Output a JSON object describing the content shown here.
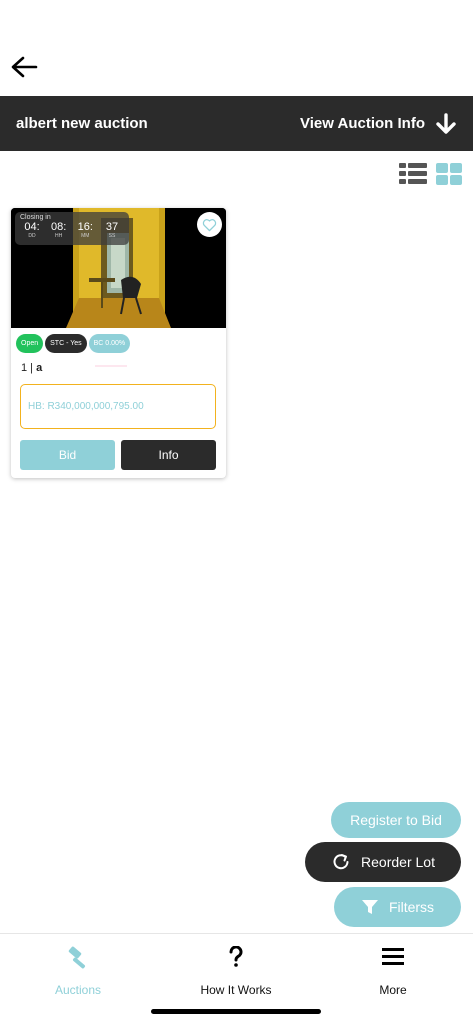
{
  "nav": {
    "back_icon": "arrow-left-icon"
  },
  "header": {
    "title": "albert new auction",
    "view_info_label": "View Auction Info",
    "view_info_icon": "arrow-down-icon"
  },
  "view_toggles": {
    "list_icon": "list-view-icon",
    "grid_icon": "grid-view-icon",
    "active": "grid"
  },
  "lot_card": {
    "timer": {
      "label": "Closing in",
      "days": "04:",
      "hours": "08:",
      "minutes": "16:",
      "seconds": "37",
      "days_unit": "DD",
      "hours_unit": "HH",
      "minutes_unit": "MM",
      "seconds_unit": "SS"
    },
    "favorite_icon": "heart-outline-icon",
    "badges": {
      "status": "Open",
      "stc": "STC - Yes",
      "bc": "BC 0.00%"
    },
    "lot_number": "1 |",
    "lot_name": "a",
    "highest_bid": "HB: R340,000,000,795.00",
    "bid_label": "Bid",
    "info_label": "Info"
  },
  "actions": {
    "register_label": "Register to Bid",
    "reorder_label": "Reorder Lot",
    "filter_label": "Filterss",
    "reorder_icon": "refresh-icon",
    "filter_icon": "filter-icon"
  },
  "tabbar": {
    "items": [
      {
        "label": "Auctions",
        "icon": "gavel-icon",
        "active": true
      },
      {
        "label": "How It Works",
        "icon": "question-icon",
        "active": false
      },
      {
        "label": "More",
        "icon": "menu-icon",
        "active": false
      }
    ]
  },
  "colors": {
    "accent": "#8fd0d8",
    "dark": "#2b2b2b",
    "open_green": "#22c25c",
    "hb_border": "#f2b21e"
  }
}
